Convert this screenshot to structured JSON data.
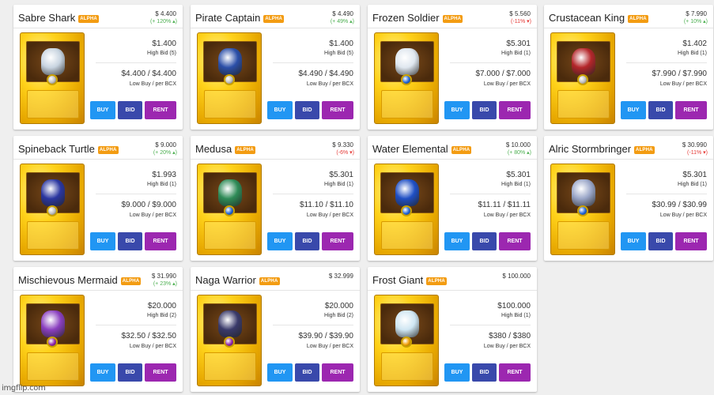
{
  "cards": [
    {
      "name": "Sabre Shark",
      "badge": "ALPHA",
      "price": "$ 4.400",
      "change": "(+ 120% ▴)",
      "change_dir": "up",
      "high_bid": "$1.400",
      "high_bid_label": "High Bid (5)",
      "low_buy": "$4.400 / $4.400",
      "low_buy_label": "Low Buy / per BCX",
      "buy": "BUY",
      "bid": "BID",
      "rent": "RENT",
      "figure_color": "#c8d4e0",
      "orb_color": "#bdbdbd"
    },
    {
      "name": "Pirate Captain",
      "badge": "ALPHA",
      "price": "$ 4.490",
      "change": "(+ 49% ▴)",
      "change_dir": "up",
      "high_bid": "$1.400",
      "high_bid_label": "High Bid (5)",
      "low_buy": "$4.490 / $4.490",
      "low_buy_label": "Low Buy / per BCX",
      "buy": "BUY",
      "bid": "BID",
      "rent": "RENT",
      "figure_color": "#2b4fa8",
      "orb_color": "#bdbdbd"
    },
    {
      "name": "Frozen Soldier",
      "badge": "ALPHA",
      "price": "$ 5.560",
      "change": "(-11% ▾)",
      "change_dir": "down",
      "high_bid": "$5.301",
      "high_bid_label": "High Bid (1)",
      "low_buy": "$7.000 / $7.000",
      "low_buy_label": "Low Buy / per BCX",
      "buy": "BUY",
      "bid": "BID",
      "rent": "RENT",
      "figure_color": "#dfe7ef",
      "orb_color": "#1e63d6"
    },
    {
      "name": "Crustacean King",
      "badge": "ALPHA",
      "price": "$ 7.990",
      "change": "(+ 10% ▴)",
      "change_dir": "up",
      "high_bid": "$1.402",
      "high_bid_label": "High Bid (1)",
      "low_buy": "$7.990 / $7.990",
      "low_buy_label": "Low Buy / per BCX",
      "buy": "BUY",
      "bid": "BID",
      "rent": "RENT",
      "figure_color": "#b4262a",
      "orb_color": "#bdbdbd"
    },
    {
      "name": "Spineback Turtle",
      "badge": "ALPHA",
      "price": "$ 9.000",
      "change": "(+ 20% ▴)",
      "change_dir": "up",
      "high_bid": "$1.993",
      "high_bid_label": "High Bid (1)",
      "low_buy": "$9.000 / $9.000",
      "low_buy_label": "Low Buy / per BCX",
      "buy": "BUY",
      "bid": "BID",
      "rent": "RENT",
      "figure_color": "#2a36a0",
      "orb_color": "#bdbdbd"
    },
    {
      "name": "Medusa",
      "badge": "ALPHA",
      "price": "$ 9.330",
      "change": "(-6% ▾)",
      "change_dir": "down",
      "high_bid": "$5.301",
      "high_bid_label": "High Bid (1)",
      "low_buy": "$11.10 / $11.10",
      "low_buy_label": "Low Buy / per BCX",
      "buy": "BUY",
      "bid": "BID",
      "rent": "RENT",
      "figure_color": "#2e8b57",
      "orb_color": "#1e63d6"
    },
    {
      "name": "Water Elemental",
      "badge": "ALPHA",
      "price": "$ 10.000",
      "change": "(+ 80% ▴)",
      "change_dir": "up",
      "high_bid": "$5.301",
      "high_bid_label": "High Bid (1)",
      "low_buy": "$11.11 / $11.11",
      "low_buy_label": "Low Buy / per BCX",
      "buy": "BUY",
      "bid": "BID",
      "rent": "RENT",
      "figure_color": "#1f4fc4",
      "orb_color": "#1e63d6"
    },
    {
      "name": "Alric Stormbringer",
      "badge": "ALPHA",
      "price": "$ 30.990",
      "change": "(-11% ▾)",
      "change_dir": "down",
      "high_bid": "$5.301",
      "high_bid_label": "High Bid (1)",
      "low_buy": "$30.99 / $30.99",
      "low_buy_label": "Low Buy / per BCX",
      "buy": "BUY",
      "bid": "BID",
      "rent": "RENT",
      "figure_color": "#9aa6c8",
      "orb_color": "#1e63d6"
    },
    {
      "name": "Mischievous Mermaid",
      "badge": "ALPHA",
      "price": "$ 31.990",
      "change": "(+ 23% ▴)",
      "change_dir": "up",
      "high_bid": "$20.000",
      "high_bid_label": "High Bid (2)",
      "low_buy": "$32.50 / $32.50",
      "low_buy_label": "Low Buy / per BCX",
      "buy": "BUY",
      "bid": "BID",
      "rent": "RENT",
      "figure_color": "#8a3fbf",
      "orb_color": "#8e24aa"
    },
    {
      "name": "Naga Warrior",
      "badge": "ALPHA",
      "price": "$ 32.999",
      "change": "",
      "change_dir": "up",
      "high_bid": "$20.000",
      "high_bid_label": "High Bid (2)",
      "low_buy": "$39.90 / $39.90",
      "low_buy_label": "Low Buy / per BCX",
      "buy": "BUY",
      "bid": "BID",
      "rent": "RENT",
      "figure_color": "#3a3a6a",
      "orb_color": "#8e24aa"
    },
    {
      "name": "Frost Giant",
      "badge": "ALPHA",
      "price": "$ 100.000",
      "change": "",
      "change_dir": "up",
      "high_bid": "$100.000",
      "high_bid_label": "High Bid (1)",
      "low_buy": "$380 / $380",
      "low_buy_label": "Low Buy / per BCX",
      "buy": "BUY",
      "bid": "BID",
      "rent": "RENT",
      "figure_color": "#cfe6f2",
      "orb_color": "#f29f05"
    }
  ],
  "watermark": "imgflip.com"
}
